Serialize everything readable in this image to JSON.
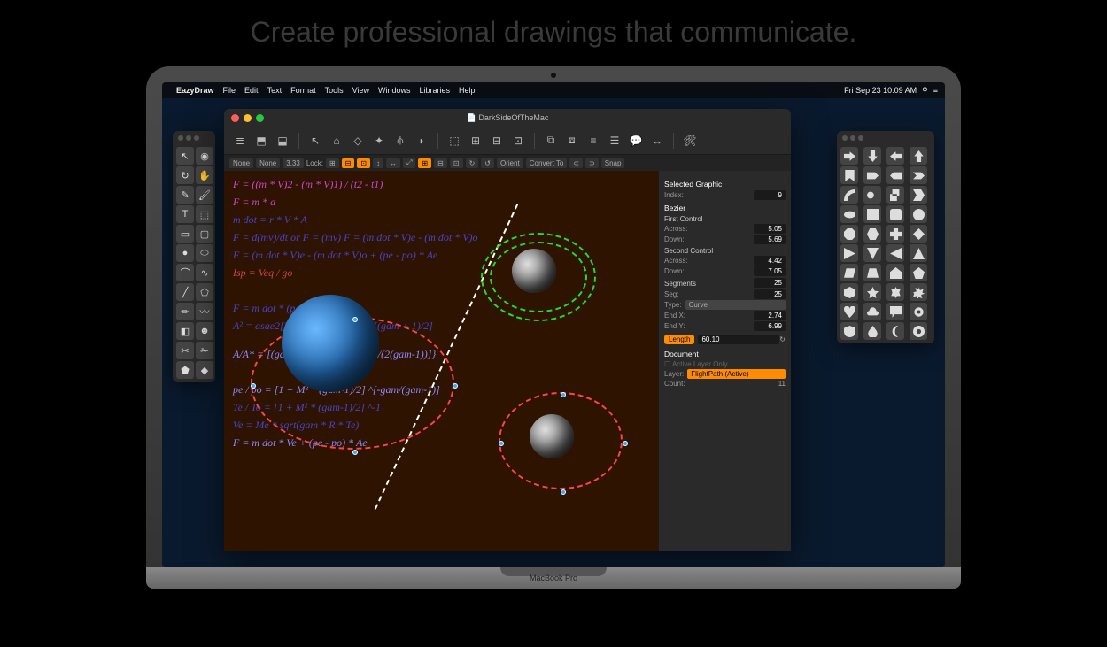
{
  "tagline": "Create professional drawings that communicate.",
  "menubar": {
    "app": "EazyDraw",
    "items": [
      "File",
      "Edit",
      "Text",
      "Format",
      "Tools",
      "View",
      "Windows",
      "Libraries",
      "Help"
    ],
    "clock": "Fri Sep 23  10:09 AM"
  },
  "doc": {
    "title": "DarkSideOfTheMac",
    "subbar": {
      "none1": "None",
      "none2": "None",
      "scale": "3.33",
      "lock": "Lock:",
      "orient": "Orient",
      "convert": "Convert To",
      "snap": "Snap"
    }
  },
  "formulas": [
    "F = ((m * V)2 - (m * V)1) / (t2 - t1)",
    "F = m * a",
    "m dot = r * V * A",
    "F = d(mv)/dt or F = (mv)  F = (m dot * V)e - (m dot * V)o",
    "F = (m dot * V)e - (m dot * V)o + (pe - po) * Ae",
    "Isp = Veq / go",
    "F = m dot * (pe - po) * Ae",
    "A² = asae2[TR] * sqrt(gam/R) * [(gam + 1)/2]",
    "A/A* = [(gam+1)/2] ^{-[(gam+1)/(2(gam-1))]}",
    "pe / po = [1 + M² * (gam-1)/2] ^[-gam/(gam-1)]",
    "Te / To = [1 + M² * (gam-1)/2] ^-1",
    "Ve = Me * sqrt(gam * R * Te)",
    "F = m dot * Ve + (pe - po) * Ae"
  ],
  "inspector": {
    "title": "Selected Graphic",
    "index_label": "Index:",
    "index_val": "9",
    "bezier": "Bezier",
    "first": "First Control",
    "across1": "Across:",
    "across1v": "5.05",
    "down1": "Down:",
    "down1v": "5.69",
    "second": "Second Control",
    "across2": "Across:",
    "across2v": "4.42",
    "down2": "Down:",
    "down2v": "7.05",
    "segments": "Segments",
    "segments_v": "25",
    "seg": "Seg:",
    "seg_v": "25",
    "type": "Type:",
    "type_v": "Curve",
    "endx": "End X:",
    "endx_v": "2.74",
    "endy": "End Y:",
    "endy_v": "6.99",
    "length": "Length",
    "length_v": "60.10",
    "document": "Document",
    "active": "Active Layer Only",
    "layer": "Layer:",
    "layer_v": "FlightPath (Active)",
    "count": "Count:",
    "count_v": "11"
  },
  "brand": "MacBook Pro"
}
